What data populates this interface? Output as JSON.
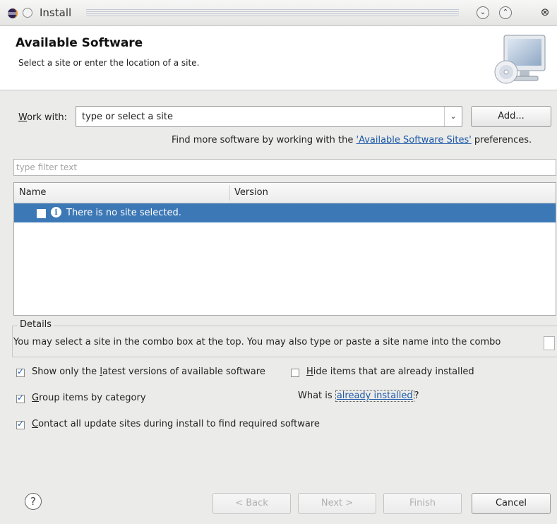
{
  "window": {
    "title": "Install",
    "icons": {
      "app": "eclipse-icon",
      "pin": "pin-icon",
      "minimize": "minimize-icon",
      "maximize": "maximize-icon",
      "close": "close-icon"
    }
  },
  "banner": {
    "title": "Available Software",
    "subtitle": "Select a site or enter the location of a site.",
    "icon": "monitor-cd-icon"
  },
  "work_with": {
    "label": "Work with:",
    "value": "type or select a site",
    "add_label": "Add..."
  },
  "find_more": {
    "prefix": "Find more software by working with the ",
    "link": "'Available Software Sites'",
    "suffix": " preferences."
  },
  "filter": {
    "placeholder": "type filter text"
  },
  "table": {
    "columns": [
      "Name",
      "Version"
    ],
    "rows": [
      {
        "checked": false,
        "icon": "info-icon",
        "name": "There is no site selected.",
        "version": "",
        "selected": true
      }
    ]
  },
  "details": {
    "label": "Details",
    "text": "You may select a site in the combo box at the top.  You may also type or paste a site name into the combo"
  },
  "options": {
    "show_latest": {
      "label": "Show only the latest versions of available software",
      "checked": true
    },
    "hide_installed": {
      "label": "Hide items that are already installed",
      "checked": false
    },
    "group_by_category": {
      "label": "Group items by category",
      "checked": true
    },
    "what_is_prefix": "What is ",
    "what_is_link": "already installed",
    "what_is_suffix": "?",
    "contact_all": {
      "label": "Contact all update sites during install to find required software",
      "checked": true
    }
  },
  "footer": {
    "help_icon": "help-icon",
    "back_label": "< Back",
    "next_label": "Next >",
    "finish_label": "Finish",
    "cancel_label": "Cancel"
  }
}
